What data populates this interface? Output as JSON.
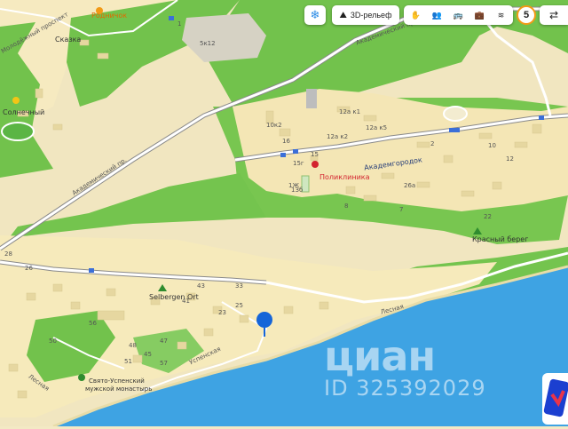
{
  "toolbar": {
    "snow_icon": "snowflake-icon",
    "relief_label": "3D-рельеф",
    "zoom_badge": "5"
  },
  "map": {
    "places": {
      "rodnichok": "Родничок",
      "skazka": "Сказка",
      "solnechny": "Солнечный",
      "poliklinika": "Поликлиника",
      "akademgorodok": "Академгородок",
      "krasny_bereg": "Красный берег",
      "selbergen": "Selbergen Ort",
      "monastery_1": "Свято-Успенский",
      "monastery_2": "мужской монастырь"
    },
    "streets": {
      "akademicheskiy": "Академический пр.",
      "akademicheskiy_top": "Академический проспект",
      "lesnaya": "Лесная",
      "lesnaya_left": "Лесная",
      "uspenskaya": "Успенская",
      "molodezhny": "Молодёжный проспект"
    },
    "house_numbers": [
      "1",
      "2",
      "7",
      "8",
      "10",
      "12",
      "12а к1",
      "12а к2",
      "12а к5",
      "15",
      "15г",
      "16",
      "23",
      "25",
      "26",
      "28",
      "33",
      "41",
      "43",
      "45",
      "47",
      "48",
      "50",
      "51",
      "56",
      "57",
      "1Ж",
      "10к2",
      "1Зб",
      "5к12",
      "26а",
      "22"
    ]
  },
  "watermark": {
    "logo": "циан",
    "id": "ID 325392029"
  },
  "colors": {
    "water": "#3ea3e3",
    "green": "#6fc14b",
    "sand": "#efe4b6",
    "residential": "#f6e9b9",
    "road": "#ffffff",
    "pin": "#1565d8",
    "zoom_ring": "#f29a16"
  }
}
